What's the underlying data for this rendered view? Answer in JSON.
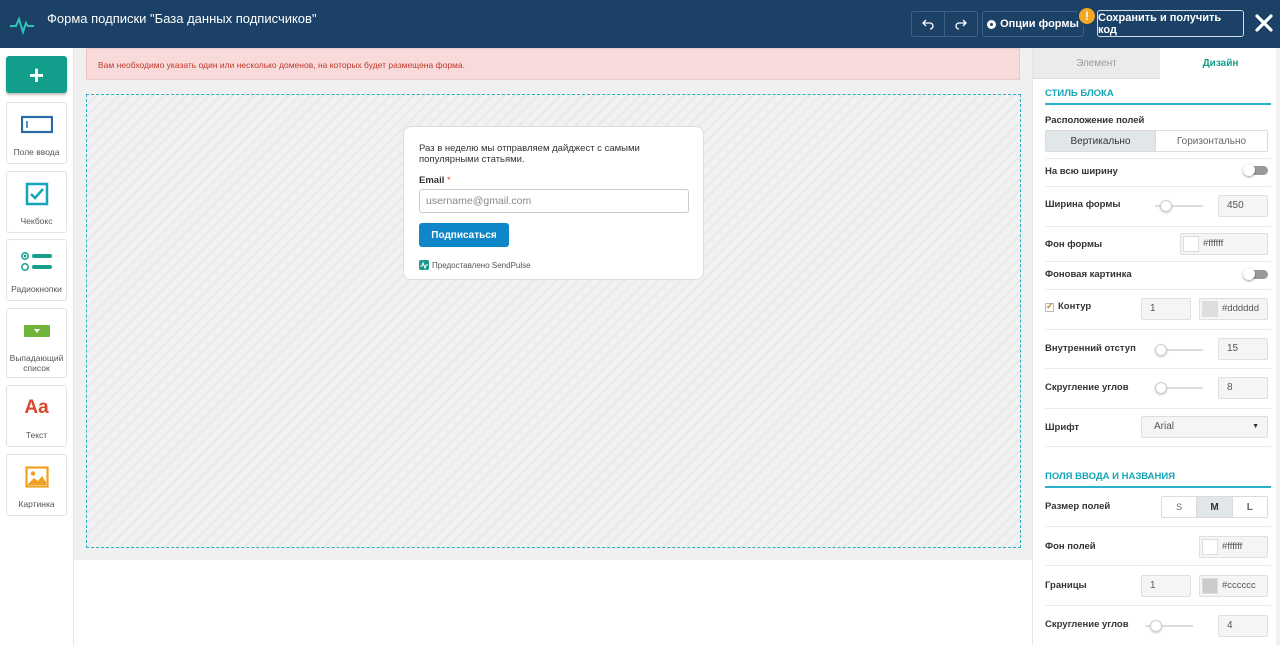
{
  "header": {
    "title": "Форма подписки \"База данных подписчиков\"",
    "options_label": "Опции формы",
    "warning_symbol": "!",
    "save_label": "Сохранить и получить код"
  },
  "leftbar": {
    "add_symbol": "+",
    "tools": [
      {
        "label": "Поле ввода",
        "icon": "input-field-icon"
      },
      {
        "label": "Чекбокс",
        "icon": "checkbox-icon"
      },
      {
        "label": "Радиокнопки",
        "icon": "radio-buttons-icon"
      },
      {
        "label": "Выпадающий список",
        "icon": "dropdown-icon"
      },
      {
        "label": "Текст",
        "icon": "text-icon"
      },
      {
        "label": "Картинка",
        "icon": "image-icon"
      }
    ],
    "text_icon_glyph": "Aa"
  },
  "alert": {
    "message": "Вам необходимо указать один или несколько доменов, на которых будет размещена форма."
  },
  "form": {
    "description": "Раз в неделю мы отправляем дайджест с самыми популярными статьями.",
    "email_label": "Email",
    "required_mark": "*",
    "email_placeholder": "username@gmail.com",
    "button_label": "Подписаться",
    "powered_by": "Предоставлено SendPulse"
  },
  "panel": {
    "tabs": [
      {
        "label": "Элемент",
        "active": false
      },
      {
        "label": "Дизайн",
        "active": true
      }
    ],
    "block_style": {
      "title": "СТИЛЬ БЛОКА",
      "layout_label": "Расположение полей",
      "layout_options": [
        "Вертикально",
        "Горизонтально"
      ],
      "layout_selected": "Вертикально",
      "full_width_label": "На всю ширину",
      "full_width_on": false,
      "form_width_label": "Ширина формы",
      "form_width_value": "450",
      "form_bg_label": "Фон формы",
      "form_bg_value": "#ffffff",
      "bg_image_label": "Фоновая картинка",
      "bg_image_on": false,
      "outline_label": "Контур",
      "outline_checked": true,
      "outline_width": "1",
      "outline_color": "#dddddd",
      "padding_label": "Внутренний отступ",
      "padding_value": "15",
      "radius_label": "Скругление углов",
      "radius_value": "8",
      "font_label": "Шрифт",
      "font_value": "Arial"
    },
    "inputs": {
      "title": "ПОЛЯ ВВОДА И НАЗВАНИЯ",
      "size_label": "Размер полей",
      "size_options": [
        "S",
        "M",
        "L"
      ],
      "size_selected": "M",
      "bg_label": "Фон полей",
      "bg_value": "#ffffff",
      "border_label": "Границы",
      "border_width": "1",
      "border_color": "#cccccc",
      "radius_label": "Скругление углов",
      "radius_value": "4"
    }
  },
  "colors": {
    "header_bg": "#1b4266",
    "accent_teal": "#119f8b",
    "button_blue": "#0e86c7",
    "alert_bg": "#f8dadb",
    "section_title": "#14a5b8"
  }
}
